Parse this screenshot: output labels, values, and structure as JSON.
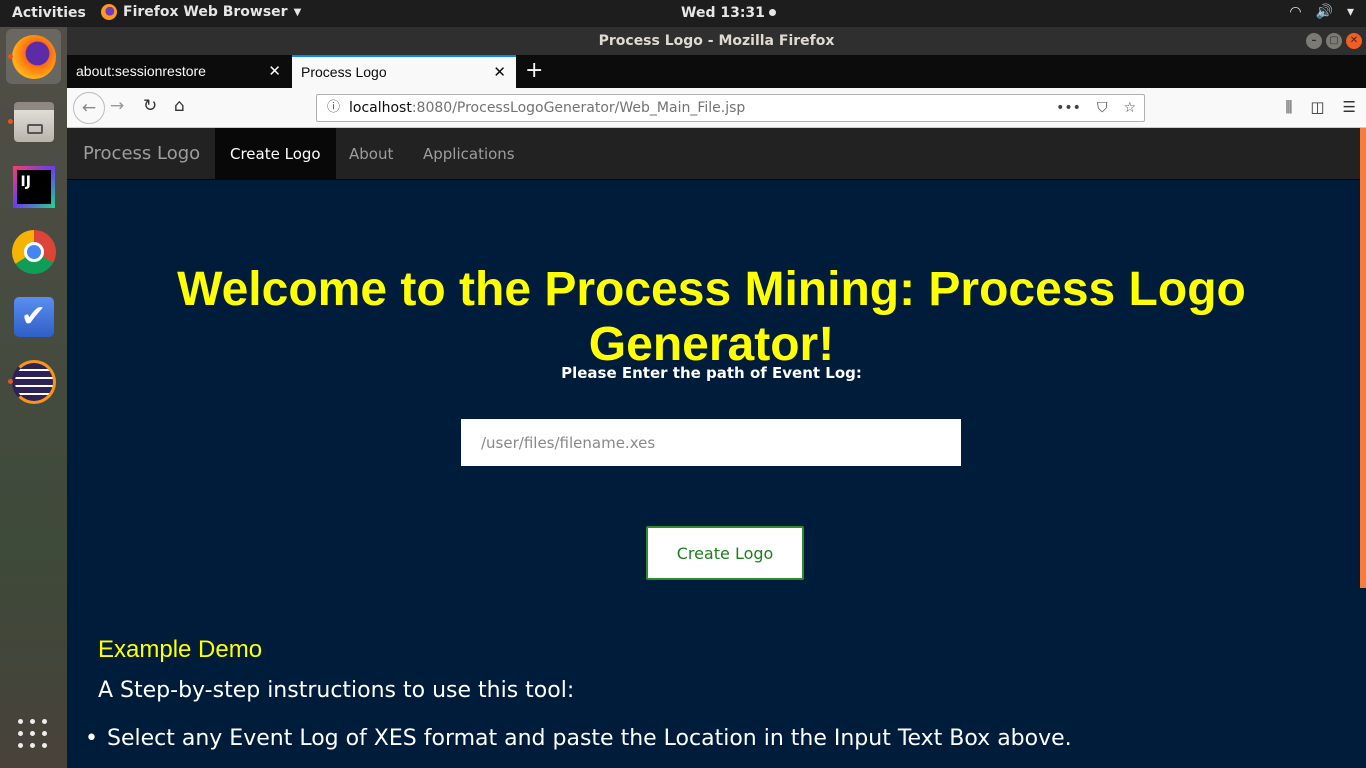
{
  "topbar": {
    "activities": "Activities",
    "app_name": "Firefox Web Browser",
    "clock": "Wed 13:31"
  },
  "window": {
    "title": "Process Logo - Mozilla Firefox"
  },
  "tabs": [
    {
      "label": "about:sessionrestore"
    },
    {
      "label": "Process Logo"
    }
  ],
  "urlbar": {
    "host": "localhost",
    "path": ":8080/ProcessLogoGenerator/Web_Main_File.jsp"
  },
  "site": {
    "brand": "Process Logo",
    "nav": [
      {
        "label": "Create Logo"
      },
      {
        "label": "About"
      },
      {
        "label": "Applications"
      }
    ],
    "welcome": "Welcome to the Process Mining: Process Logo Generator!",
    "prompt": "Please Enter the path of Event Log:",
    "input_placeholder": "/user/files/filename.xes",
    "create_button": "Create Logo",
    "demo_title": "Example Demo",
    "steps_intro": "A Step-by-step instructions to use this tool:",
    "steps": [
      "Select any Event Log of XES format and paste the Location in the Input Text Box above."
    ]
  }
}
